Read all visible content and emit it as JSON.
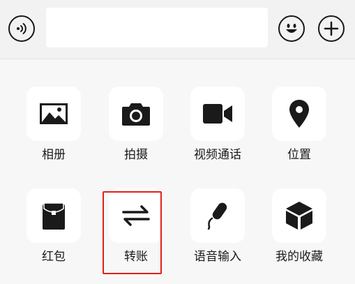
{
  "input_bar": {
    "voice_icon": "voice-wave-icon",
    "emoji_icon": "smiley-face-icon",
    "plus_icon": "plus-icon",
    "text_value": ""
  },
  "panel": {
    "items": [
      {
        "label": "相册",
        "icon": "photo-album-icon"
      },
      {
        "label": "拍摄",
        "icon": "camera-icon"
      },
      {
        "label": "视频通话",
        "icon": "video-call-icon"
      },
      {
        "label": "位置",
        "icon": "location-pin-icon"
      },
      {
        "label": "红包",
        "icon": "red-packet-icon"
      },
      {
        "label": "转账",
        "icon": "transfer-arrows-icon"
      },
      {
        "label": "语音输入",
        "icon": "microphone-icon"
      },
      {
        "label": "我的收藏",
        "icon": "favorites-cube-icon"
      }
    ]
  },
  "colors": {
    "highlight_border": "#e0201b",
    "icon": "#1a1a1a",
    "tile_background": "#ffffff",
    "panel_background": "#f7f7f7"
  }
}
